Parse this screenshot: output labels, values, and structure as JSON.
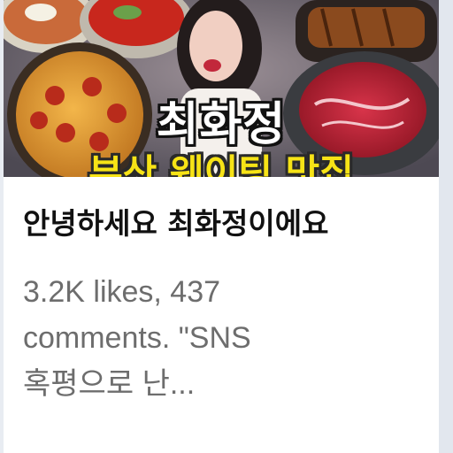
{
  "thumbnail": {
    "overlay_title": "최화정",
    "overlay_subtitle": "부산 웨이팅 맛집"
  },
  "post": {
    "title": "안녕하세요 최화정이에요",
    "description_lines": [
      "3.2K likes, 437",
      "comments. \"SNS",
      "혹평으로 난..."
    ],
    "footer_peek": ". . . ."
  },
  "colors": {
    "subtitle_yellow": "#f7e316",
    "description_gray": "#6d6d6d",
    "title_black": "#111111"
  }
}
